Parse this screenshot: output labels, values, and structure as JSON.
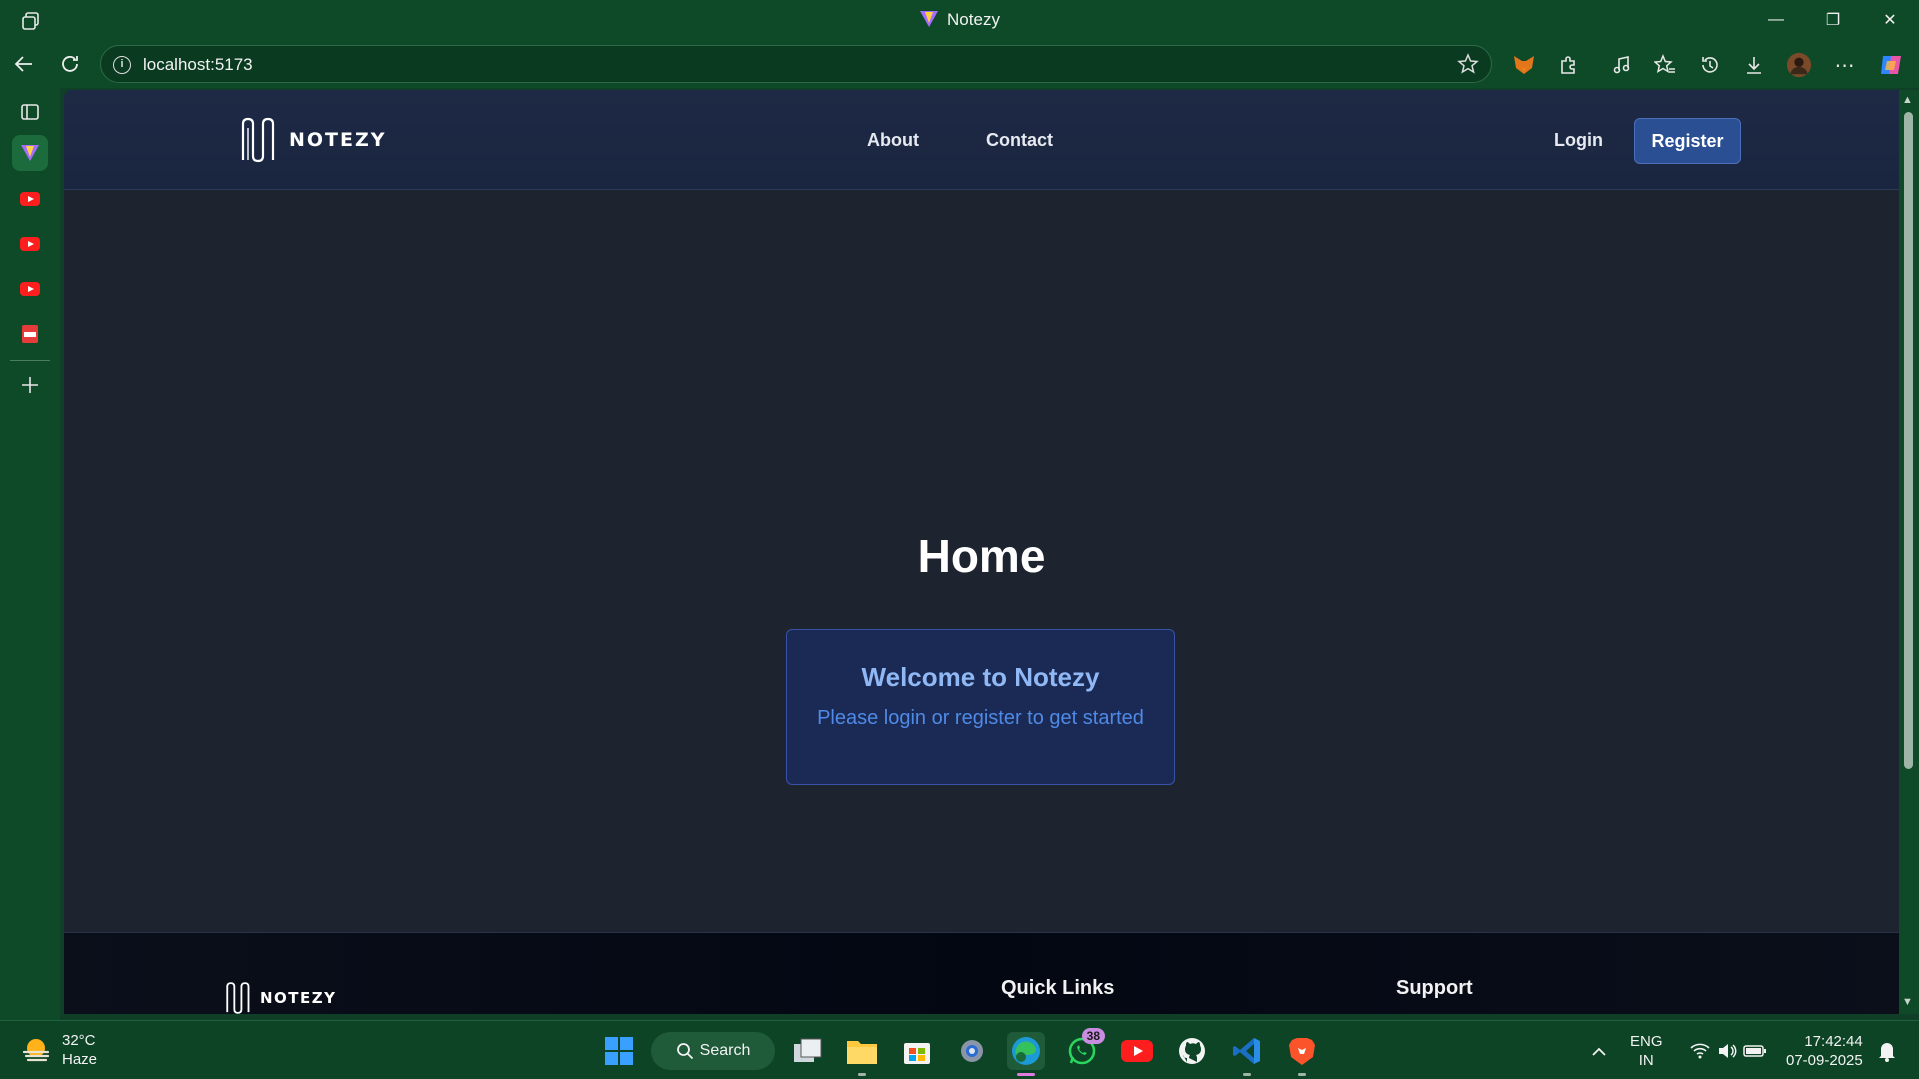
{
  "browser": {
    "window_title": "Notezy",
    "url": "localhost:5173",
    "sidebar_items": [
      "vertical-tabs",
      "notezy-tab",
      "youtube-tab-1",
      "youtube-tab-2",
      "youtube-tab-3",
      "pdf-tab",
      "add-tab"
    ]
  },
  "app": {
    "logo_text": "NOTEZY",
    "nav": {
      "about": "About",
      "contact": "Contact",
      "login": "Login",
      "register": "Register"
    },
    "home_title": "Home",
    "welcome": {
      "title": "Welcome to Notezy",
      "subtitle": "Please login or register to get started"
    },
    "footer": {
      "logo_text": "NOTEZY",
      "quick_links": "Quick Links",
      "support": "Support"
    }
  },
  "taskbar": {
    "weather_temp": "32°C",
    "weather_desc": "Haze",
    "search_label": "Search",
    "whatsapp_badge": "38",
    "lang_line1": "ENG",
    "lang_line2": "IN",
    "time": "17:42:44",
    "date": "07-09-2025"
  },
  "colors": {
    "browser_chrome": "#0f4a28",
    "page_bg": "#1e2330",
    "header_bg": "#1e2a45",
    "register_bg": "#2a4f93",
    "card_bg": "#1b2a55",
    "card_title": "#8fb8f5",
    "card_sub": "#4f8ae6"
  }
}
